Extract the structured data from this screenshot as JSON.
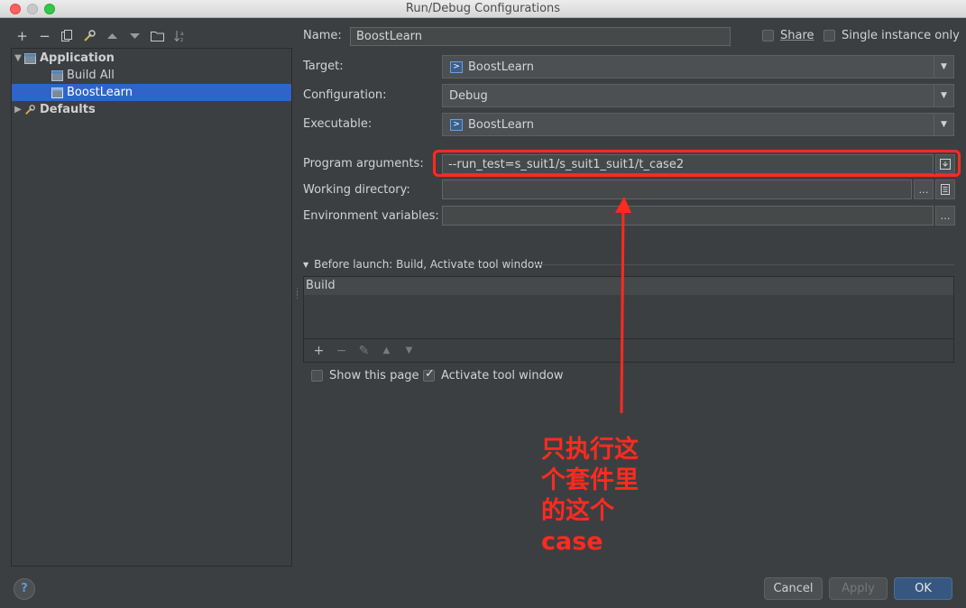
{
  "window": {
    "title": "Run/Debug Configurations"
  },
  "tree": {
    "items": [
      {
        "label": "Application"
      },
      {
        "label": "Build All"
      },
      {
        "label": "BoostLearn"
      },
      {
        "label": "Defaults"
      }
    ]
  },
  "form": {
    "name_label": "Name:",
    "name_value": "BoostLearn",
    "share_label": "Share",
    "single_instance_label": "Single instance only",
    "target_label": "Target:",
    "target_value": "BoostLearn",
    "configuration_label": "Configuration:",
    "configuration_value": "Debug",
    "executable_label": "Executable:",
    "executable_value": "BoostLearn",
    "program_args_label": "Program arguments:",
    "program_args_value": "--run_test=s_suit1/s_suit1_suit1/t_case2",
    "working_dir_label": "Working directory:",
    "working_dir_value": "",
    "env_vars_label": "Environment variables:",
    "env_vars_value": ""
  },
  "before_launch": {
    "header": "Before launch: Build, Activate tool window",
    "items": [
      "Build"
    ],
    "show_page_label": "Show this page",
    "activate_label": "Activate tool window"
  },
  "buttons": {
    "help": "?",
    "cancel": "Cancel",
    "apply": "Apply",
    "ok": "OK"
  },
  "annotation": {
    "text": "只执行这\n个套件里\n的这个\ncase",
    "color": "#ff2a1f"
  }
}
